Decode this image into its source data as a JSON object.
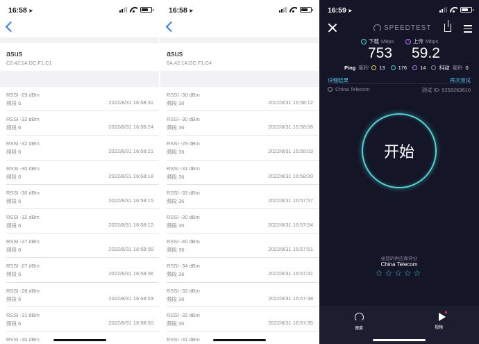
{
  "colors": {
    "accent_blue": "#2f7cf6",
    "speedtest_bg": "#141526",
    "cyan": "#4ed6d8",
    "link": "#4dc3e6"
  },
  "panel1": {
    "time": "16:58",
    "network": {
      "name": "asus",
      "mac": "C2:42:1A:DC:F1:C1"
    },
    "rows": [
      {
        "rssi": "RSSI -29 dBm",
        "band": "频段 6",
        "ts": "2022/8/31 16:58:31"
      },
      {
        "rssi": "RSSI -32 dBm",
        "band": "频段 6",
        "ts": "2022/8/31 16:58:24"
      },
      {
        "rssi": "RSSI -32 dBm",
        "band": "频段 6",
        "ts": "2022/8/31 16:58:21"
      },
      {
        "rssi": "RSSI -30 dBm",
        "band": "频段 6",
        "ts": "2022/8/31 16:58:18"
      },
      {
        "rssi": "RSSI -30 dBm",
        "band": "频段 6",
        "ts": "2022/8/31 16:58:15"
      },
      {
        "rssi": "RSSI -32 dBm",
        "band": "频段 6",
        "ts": "2022/8/31 16:58:12"
      },
      {
        "rssi": "RSSI -27 dBm",
        "band": "频段 6",
        "ts": "2022/8/31 16:58:09"
      },
      {
        "rssi": "RSSI -27 dBm",
        "band": "频段 6",
        "ts": "2022/8/31 16:58:06"
      },
      {
        "rssi": "RSSI -28 dBm",
        "band": "频段 6",
        "ts": "2022/8/31 16:58:03"
      },
      {
        "rssi": "RSSI -31 dBm",
        "band": "频段 6",
        "ts": "2022/8/31 16:58:00"
      },
      {
        "rssi": "RSSI -30 dBm",
        "band": "",
        "ts": ""
      }
    ]
  },
  "panel2": {
    "time": "16:58",
    "network": {
      "name": "asus",
      "mac": "6A:42:1A:DC:F1:C4"
    },
    "rows": [
      {
        "rssi": "RSSI -30 dBm",
        "band": "频段 36",
        "ts": "2022/8/31 16:58:12"
      },
      {
        "rssi": "RSSI -30 dBm",
        "band": "频段 36",
        "ts": "2022/8/31 16:58:06"
      },
      {
        "rssi": "RSSI -29 dBm",
        "band": "频段 36",
        "ts": "2022/8/31 16:58:03"
      },
      {
        "rssi": "RSSI -31 dBm",
        "band": "频段 36",
        "ts": "2022/8/31 16:58:00"
      },
      {
        "rssi": "RSSI -33 dBm",
        "band": "频段 36",
        "ts": "2022/8/31 16:57:57"
      },
      {
        "rssi": "RSSI -30 dBm",
        "band": "频段 36",
        "ts": "2022/8/31 16:57:54"
      },
      {
        "rssi": "RSSI -40 dBm",
        "band": "频段 36",
        "ts": "2022/8/31 16:57:51"
      },
      {
        "rssi": "RSSI -34 dBm",
        "band": "频段 36",
        "ts": "2022/8/31 16:57:41"
      },
      {
        "rssi": "RSSI -33 dBm",
        "band": "频段 36",
        "ts": "2022/8/31 16:57:38"
      },
      {
        "rssi": "RSSI -32 dBm",
        "band": "频段 36",
        "ts": "2022/8/31 16:57:35"
      },
      {
        "rssi": "RSSI -31 dBm",
        "band": "",
        "ts": ""
      }
    ]
  },
  "speedtest": {
    "time": "16:59",
    "brand": "SPEEDTEST",
    "download_label": "下载",
    "upload_label": "上传",
    "unit": "Mbps",
    "download": "753",
    "upload": "59.2",
    "ping_label": "Ping",
    "ping_unit": "毫秒",
    "ping_idle": "13",
    "ping_download": "176",
    "ping_upload": "14",
    "jitter_label": "抖动",
    "jitter_unit": "毫秒",
    "jitter": "0",
    "details_link": "详细结果",
    "retest_link": "再次测试",
    "isp": "China Telecom",
    "test_id": "测试 ID: 5258263610",
    "go_label": "开始",
    "rate_title": "给您的供应商评分",
    "rate_isp": "China Telecom",
    "stars": "☆☆☆☆☆",
    "tabs": {
      "speed": "速度",
      "video": "视频"
    }
  }
}
